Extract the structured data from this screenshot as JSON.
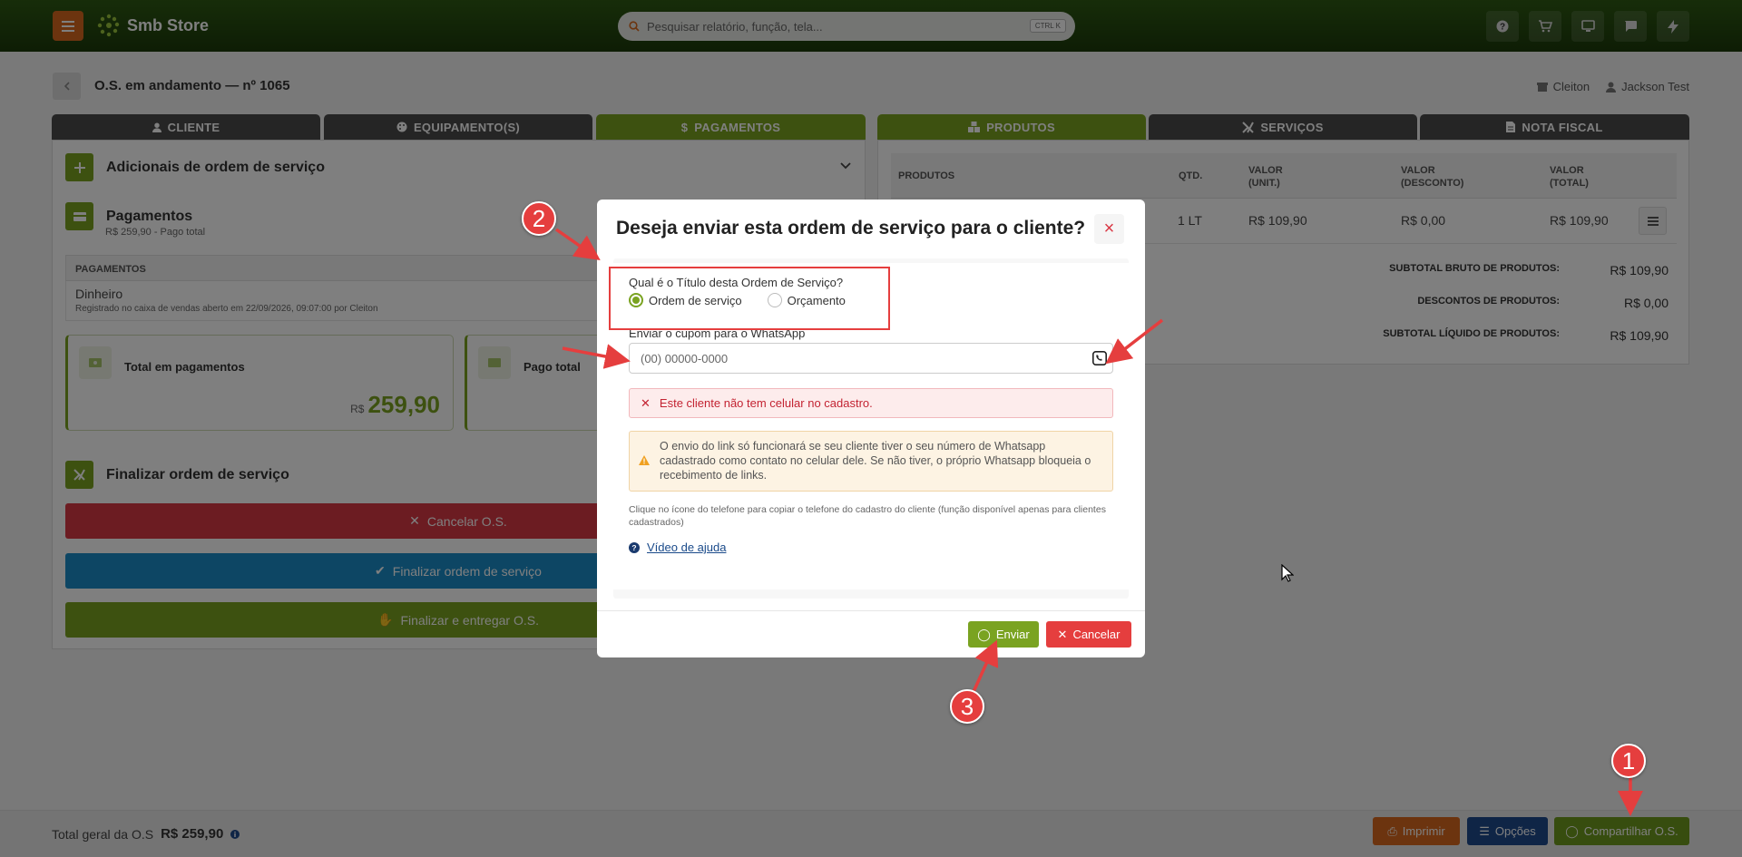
{
  "app": {
    "brand": "Smb Store"
  },
  "search": {
    "placeholder": "Pesquisar relatório, função, tela...",
    "shortcut": "CTRL K"
  },
  "page": {
    "title": "O.S. em andamento — nº 1065",
    "store": "Cleiton",
    "user": "Jackson Test"
  },
  "tabs_left": [
    {
      "label": "CLIENTE",
      "icon": "user-icon"
    },
    {
      "label": "EQUIPAMENTO(S)",
      "icon": "palette-icon"
    },
    {
      "label": "PAGAMENTOS",
      "icon": "dollar-icon"
    }
  ],
  "tabs_right": [
    {
      "label": "PRODUTOS",
      "icon": "boxes-icon"
    },
    {
      "label": "SERVIÇOS",
      "icon": "tools-icon"
    },
    {
      "label": "NOTA FISCAL",
      "icon": "file-icon"
    }
  ],
  "left": {
    "additions_title": "Adicionais de ordem de serviço",
    "payments_title": "Pagamentos",
    "payments_sub": "R$ 259,90 - Pago total",
    "payments_header": "PAGAMENTOS",
    "payment_method": "Dinheiro",
    "payment_note": "Registrado no caixa de vendas aberto em 22/09/2026, 09:07:00 por Cleiton",
    "card_total_label": "Total em pagamentos",
    "card_total_currency": "R$",
    "card_total_value": "259,90",
    "card_paid_label": "Pago total",
    "finalize_title": "Finalizar ordem de serviço",
    "btn_cancel": "Cancelar O.S.",
    "btn_finalize": "Finalizar ordem de serviço",
    "btn_finalize_deliver": "Finalizar e entregar O.S."
  },
  "products": {
    "columns": [
      "PRODUTOS",
      "QTD.",
      "VALOR (UNIT.)",
      "VALOR (DESCONTO)",
      "VALOR (TOTAL)"
    ],
    "col_unit_a": "VALOR",
    "col_unit_b": "(UNIT.)",
    "col_disc_a": "VALOR",
    "col_disc_b": "(DESCONTO)",
    "col_total_a": "VALOR",
    "col_total_b": "(TOTAL)",
    "row": {
      "qty": "1 LT",
      "unit": "R$ 109,90",
      "discount": "R$ 0,00",
      "total": "R$ 109,90"
    },
    "subtotal_gross_label": "SUBTOTAL BRUTO DE PRODUTOS:",
    "subtotal_gross": "R$ 109,90",
    "discounts_label": "DESCONTOS DE PRODUTOS:",
    "discounts": "R$ 0,00",
    "subtotal_net_label": "SUBTOTAL LÍQUIDO DE PRODUTOS:",
    "subtotal_net": "R$ 109,90"
  },
  "footer": {
    "total_label": "Total geral da O.S",
    "total_value": "R$ 259,90",
    "print": "Imprimir",
    "options": "Opções",
    "share": "Compartilhar O.S."
  },
  "modal": {
    "title": "Deseja enviar esta ordem de serviço para o cliente?",
    "question": "Qual é o Título desta Ordem de Serviço?",
    "option_os": "Ordem de serviço",
    "option_quote": "Orçamento",
    "selected": "Ordem de serviço",
    "phone_label": "Enviar o cupom para o WhatsApp",
    "phone_placeholder": "(00) 00000-0000",
    "error": "Este cliente não tem celular no cadastro.",
    "warning": "O envio do link só funcionará se seu cliente tiver o seu número de Whatsapp cadastrado como contato no celular dele. Se não tiver, o próprio Whatsapp bloqueia o recebimento de links.",
    "hint": "Clique no ícone do telefone para copiar o telefone do cadastro do cliente (função disponível apenas para clientes cadastrados)",
    "help": "Vídeo de ajuda",
    "send": "Enviar",
    "cancel": "Cancelar"
  },
  "annotations": {
    "step1": "1",
    "step2": "2",
    "step3": "3"
  },
  "colors": {
    "brand_green": "#7aa321",
    "topbar": "#2e5a13",
    "danger": "#d93845",
    "info": "#1a8dc9",
    "orange": "#d9681e",
    "navy": "#1f4a8c"
  }
}
